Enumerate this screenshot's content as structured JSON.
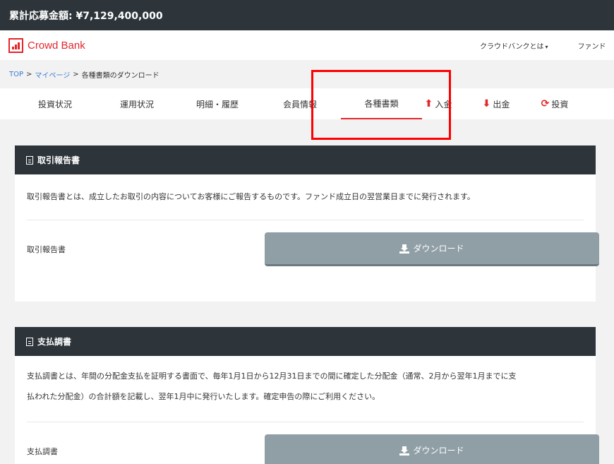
{
  "topbar": {
    "total_label": "累計応募金額: ¥7,129,400,000"
  },
  "header": {
    "logo_text": "Crowd Bank",
    "nav_about": "クラウドバンクとは",
    "nav_fund": "ファンド"
  },
  "breadcrumb": {
    "top": "TOP",
    "mypage": "マイページ",
    "current": "各種書類のダウンロード",
    "sep": ">"
  },
  "tabs": {
    "invest_status": "投資状況",
    "operation_status": "運用状況",
    "statement_history": "明細・履歴",
    "member_info": "会員情報",
    "documents": "各種書類",
    "deposit": "入金",
    "withdraw": "出金",
    "invest": "投資"
  },
  "icons": {
    "deposit": "arrow-up-icon",
    "withdraw": "arrow-down-icon",
    "invest": "refresh-icon",
    "doc": "document-icon",
    "download": "download-icon"
  },
  "colors": {
    "accent": "#e5252c",
    "dark_header": "#2d353b",
    "button": "#909fa6"
  },
  "sections": {
    "trade_report": {
      "title": "取引報告書",
      "description": "取引報告書とは、成立したお取引の内容についてお客様にご報告するものです。ファンド成立日の翌営業日までに発行されます。",
      "row_label": "取引報告書",
      "button_label": "ダウンロード"
    },
    "payment_report": {
      "title": "支払調書",
      "description_line1": "支払調書とは、年間の分配金支払を証明する書面で、毎年1月1日から12月31日までの間に確定した分配金（通常、2月から翌年1月までに支",
      "description_line2": "払われた分配金）の合計額を記載し、翌年1月中に発行いたします。確定申告の際にご利用ください。",
      "row_label": "支払調書",
      "button_label": "ダウンロード"
    }
  }
}
